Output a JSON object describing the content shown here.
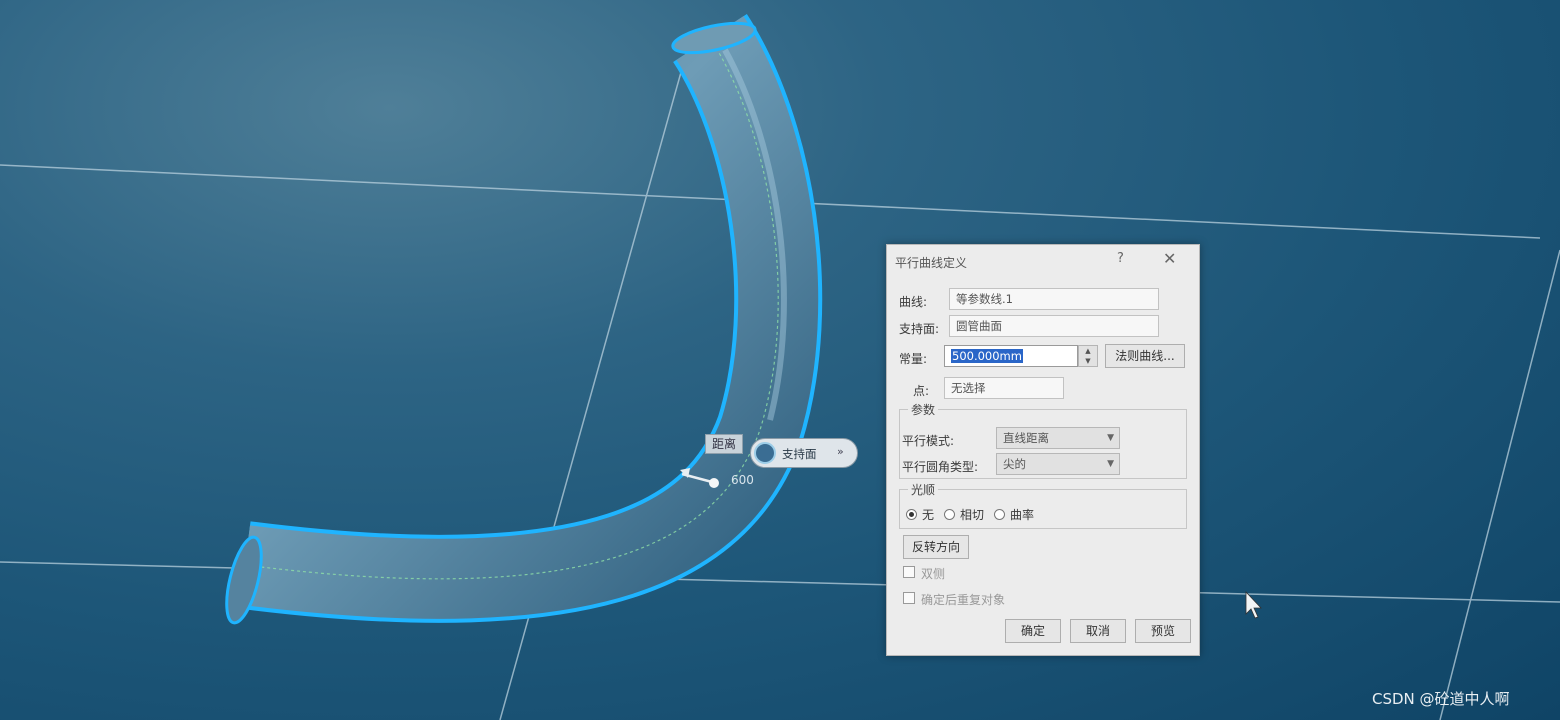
{
  "dialog": {
    "title": "平行曲线定义",
    "help_icon": "?",
    "close_icon": "✕",
    "curve_label": "曲线:",
    "curve_value": "等参数线.1",
    "support_label": "支持面:",
    "support_value": "圆管曲面",
    "constant_label": "常量:",
    "constant_value": "500.000mm",
    "law_button": "法则曲线...",
    "point_label": "点:",
    "point_value": "无选择",
    "params_group": "参数",
    "parallel_mode_label": "平行模式:",
    "parallel_mode_value": "直线距离",
    "corner_type_label": "平行圆角类型:",
    "corner_type_value": "尖的",
    "smooth_group": "光顺",
    "smooth_options": [
      "无",
      "相切",
      "曲率"
    ],
    "smooth_selected": "无",
    "reverse_button": "反转方向",
    "both_sides_label": "双侧",
    "repeat_label": "确定后重复对象",
    "ok_button": "确定",
    "cancel_button": "取消",
    "preview_button": "预览"
  },
  "viewport": {
    "distance_tag": "距离",
    "support_tag": "支持面",
    "support_tag_arrow": "»",
    "value_readout": "600"
  },
  "watermark": "CSDN @砼道中人啊",
  "colors": {
    "background": "#1d5678",
    "tube_highlight": "#1fb4ff",
    "selection": "#2a66c8"
  }
}
